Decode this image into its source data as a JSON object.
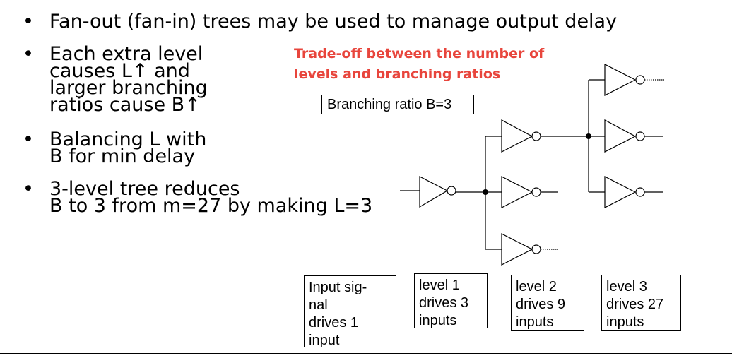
{
  "bullets": [
    {
      "lines": [
        "Fan-out (fan-in) trees may be used to manage output delay"
      ]
    },
    {
      "lines": [
        "Each extra level",
        "causes L↑ and",
        "larger branching",
        "ratios cause B↑"
      ]
    },
    {
      "lines": [
        "Balancing L with",
        "B for min delay"
      ]
    },
    {
      "lines": [
        "3-level tree reduces",
        "B to 3 from m=27 by making L=3"
      ]
    }
  ],
  "tradeoff": {
    "lines": [
      "Trade-off between the number of",
      "levels and branching ratios"
    ],
    "color": "#e8453c"
  },
  "ratio_box": "Branching ratio B=3",
  "level_boxes": [
    {
      "lines": [
        "Input sig-",
        "nal",
        "drives 1",
        "input"
      ]
    },
    {
      "lines": [
        "level 1",
        "drives 3",
        "inputs"
      ]
    },
    {
      "lines": [
        "level 2",
        "drives 9",
        "inputs"
      ]
    },
    {
      "lines": [
        "level 3",
        "drives 27",
        "inputs"
      ]
    }
  ]
}
